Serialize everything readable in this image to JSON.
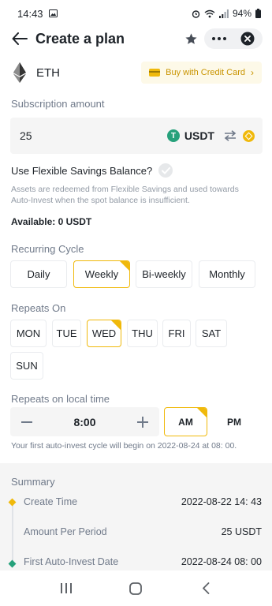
{
  "status_bar": {
    "time": "14:43",
    "battery": "94%"
  },
  "header": {
    "title": "Create a plan"
  },
  "asset": {
    "name": "ETH",
    "buy_label": "Buy with Credit Card"
  },
  "subscription": {
    "label": "Subscription amount",
    "amount": "25",
    "currency": "USDT",
    "usdt_icon_letter": "T"
  },
  "flexible": {
    "question": "Use Flexible Savings Balance?",
    "note": "Assets are redeemed from Flexible Savings and used towards Auto-Invest when the spot balance is insufficient."
  },
  "available": "Available: 0 USDT",
  "recurring": {
    "label": "Recurring Cycle",
    "options": [
      "Daily",
      "Weekly",
      "Bi-weekly",
      "Monthly"
    ],
    "selected": "Weekly"
  },
  "repeats_on": {
    "label": "Repeats On",
    "days": [
      "MON",
      "TUE",
      "WED",
      "THU",
      "FRI",
      "SAT",
      "SUN"
    ],
    "selected": "WED"
  },
  "local_time": {
    "label": "Repeats on local time",
    "time": "8:00",
    "am": "AM",
    "pm": "PM",
    "selected": "AM"
  },
  "first_cycle_note": "Your first auto-invest cycle will begin on 2022-08-24 at 08: 00.",
  "summary": {
    "title": "Summary",
    "rows": [
      {
        "label": "Create Time",
        "value": "2022-08-22 14: 43"
      },
      {
        "label": "Amount Per Period",
        "value": "25 USDT"
      },
      {
        "label": "First Auto-Invest Date",
        "value": "2022-08-24 08: 00"
      }
    ]
  },
  "colors": {
    "accent": "#f0b90b",
    "accent_text": "#c99400",
    "muted": "#707a8a",
    "green": "#26a17b"
  },
  "icons": [
    "back-arrow",
    "star",
    "more",
    "close",
    "eth",
    "credit-card",
    "usdt",
    "swap",
    "bnb-coin",
    "check",
    "minus",
    "plus",
    "nav-recents",
    "nav-home",
    "nav-back"
  ]
}
